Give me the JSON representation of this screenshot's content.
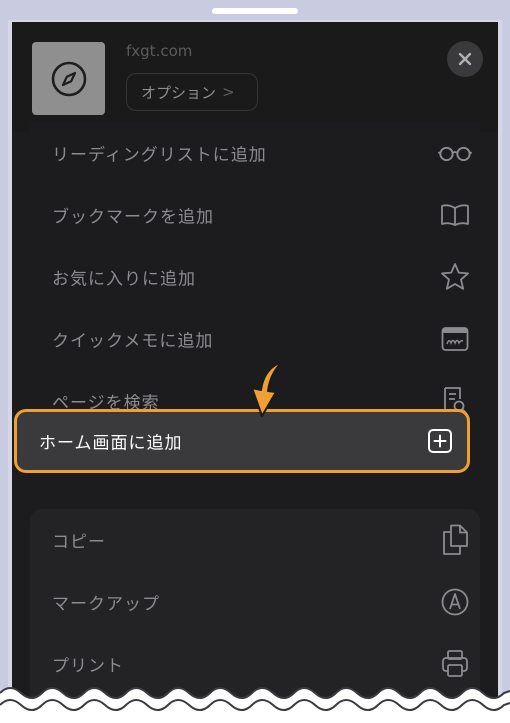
{
  "header": {
    "domain": "fxgt.com",
    "options_label": "オプション",
    "options_chevron": ">"
  },
  "menu": {
    "group1": [
      {
        "label": "リーディングリストに追加",
        "icon": "glasses-icon"
      },
      {
        "label": "ブックマークを追加",
        "icon": "book-icon"
      },
      {
        "label": "お気に入りに追加",
        "icon": "star-icon"
      },
      {
        "label": "クイックメモに追加",
        "icon": "quick-note-icon"
      },
      {
        "label": "ページを検索",
        "icon": "doc-search-icon"
      }
    ],
    "highlighted": {
      "label": "ホーム画面に追加",
      "icon": "plus-square-icon"
    },
    "group2": [
      {
        "label": "コピー",
        "icon": "copy-icon"
      },
      {
        "label": "マークアップ",
        "icon": "markup-icon"
      },
      {
        "label": "プリント",
        "icon": "print-icon"
      }
    ]
  },
  "colors": {
    "highlight_border": "#f0a033",
    "sheet_bg": "#1c1c1e",
    "label": "#8b8b90"
  }
}
